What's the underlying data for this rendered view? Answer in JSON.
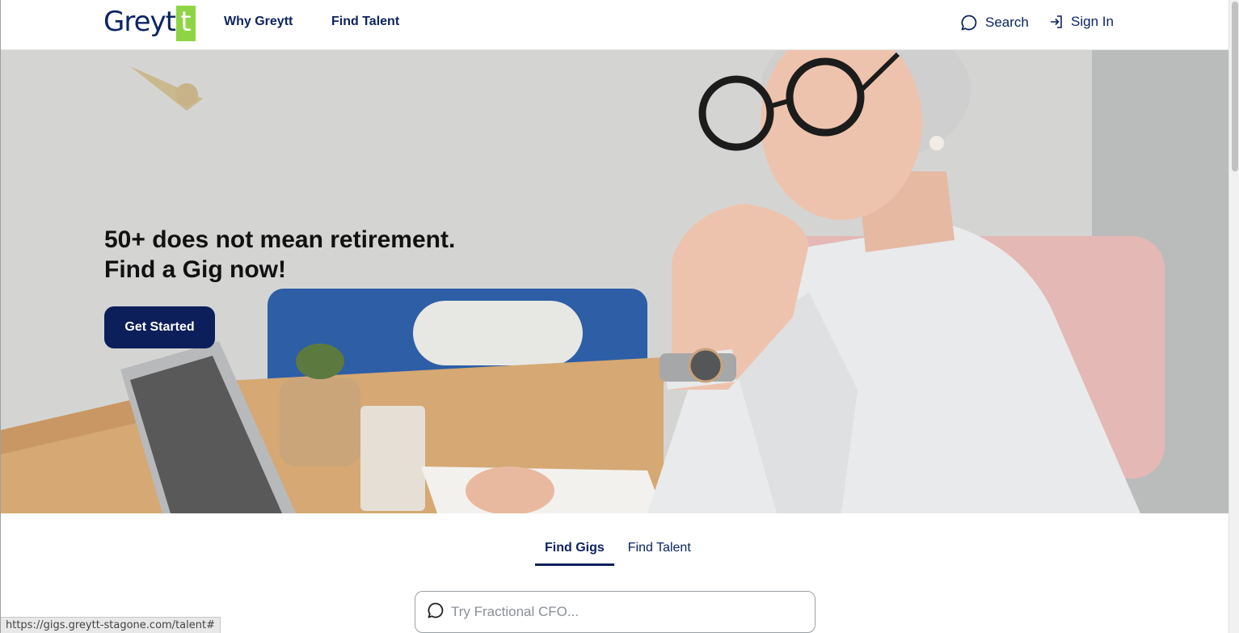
{
  "header": {
    "logo_text": "Grey",
    "logo_accent": "t",
    "logo_last": "t",
    "nav": [
      {
        "label": "Why Greytt"
      },
      {
        "label": "Find Talent"
      }
    ],
    "search_label": "Search",
    "signin_label": "Sign In",
    "icons": {
      "search": "chat-bubble-search-icon",
      "signin": "sign-in-arrow-icon"
    }
  },
  "hero": {
    "heading_line1": "50+ does not mean retirement.",
    "heading_line2": "Find a Gig now!",
    "cta_label": "Get Started",
    "image": "smiling older woman with glasses at desk with laptop"
  },
  "tabs": {
    "items": [
      {
        "label": "Find Gigs",
        "active": true
      },
      {
        "label": "Find Talent",
        "active": false
      }
    ]
  },
  "search": {
    "placeholder": "Try Fractional CFO..."
  },
  "status": {
    "url": "https://gigs.greytt-stagone.com/talent#"
  },
  "colors": {
    "brand_navy": "#0c1f5b",
    "logo_green": "#8fd444"
  }
}
